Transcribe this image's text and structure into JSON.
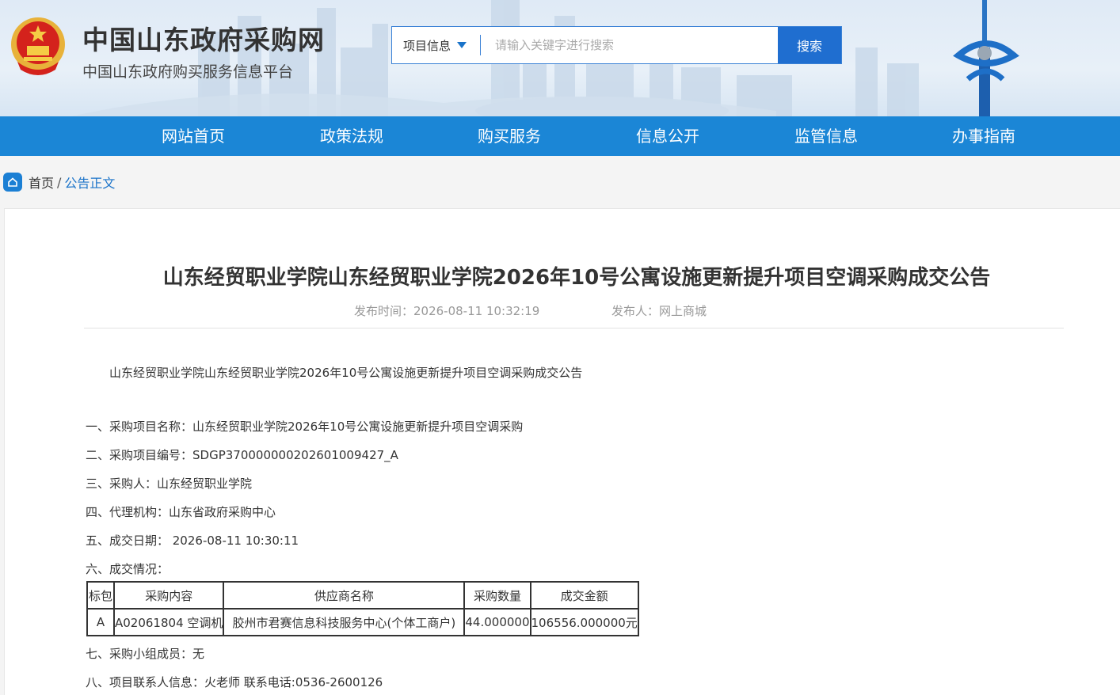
{
  "header": {
    "site_title": "中国山东政府采购网",
    "site_subtitle": "中国山东政府购买服务信息平台",
    "search": {
      "type_label": "项目信息",
      "placeholder": "请输入关键字进行搜索",
      "button_label": "搜索"
    }
  },
  "nav": {
    "items": [
      {
        "label": "网站首页"
      },
      {
        "label": "政策法规"
      },
      {
        "label": "购买服务"
      },
      {
        "label": "信息公开"
      },
      {
        "label": "监管信息"
      },
      {
        "label": "办事指南"
      }
    ]
  },
  "breadcrumb": {
    "home": "首页",
    "separator": "/",
    "current": "公告正文"
  },
  "notice": {
    "title": "山东经贸职业学院山东经贸职业学院2026年10号公寓设施更新提升项目空调采购成交公告",
    "publish_time": "发布时间：2026-08-11 10:32:19",
    "publisher": "发布人：网上商城",
    "intro": "山东经贸职业学院山东经贸职业学院2026年10号公寓设施更新提升项目空调采购成交公告",
    "items": [
      "一、采购项目名称：山东经贸职业学院2026年10号公寓设施更新提升项目空调采购",
      "二、采购项目编号：SDGP370000000202601009427_A",
      "三、采购人：山东经贸职业学院",
      "四、代理机构：山东省政府采购中心",
      "五、成交日期： 2026-08-11 10:30:11",
      "六、成交情况："
    ],
    "table": {
      "headers": [
        "标包",
        "采购内容",
        "供应商名称",
        "采购数量",
        "成交金额"
      ],
      "rows": [
        [
          "A",
          "A02061804 空调机",
          "胶州市君赛信息科技服务中心(个体工商户)",
          "44.000000",
          "106556.000000元"
        ]
      ]
    },
    "items_after": [
      "七、采购小组成员：无",
      "八、项目联系人信息：火老师 联系电话:0536-2600126"
    ]
  },
  "colors": {
    "nav_bg": "#1b86d6",
    "search_button": "#1f6ed0",
    "link": "#1a73c9"
  }
}
